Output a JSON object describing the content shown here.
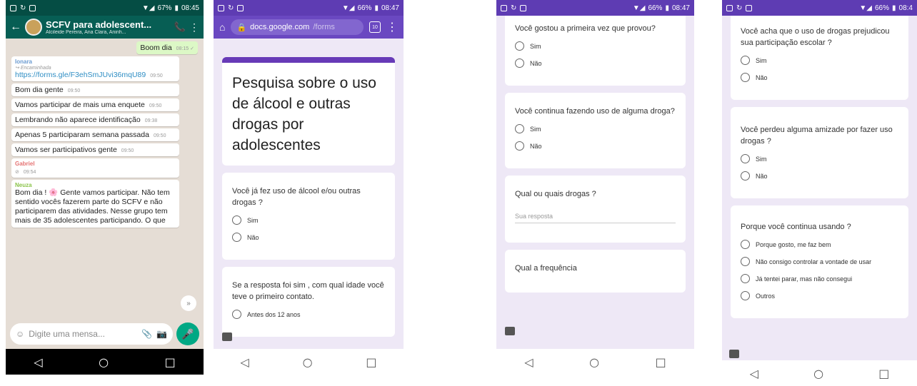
{
  "phone1": {
    "status": {
      "battery": "67%",
      "time": "08:45"
    },
    "header": {
      "title": "SCFV para adolescent...",
      "subtitle": "Alcileide Pereira, Ana Clara, Aninh..."
    },
    "messages": [
      {
        "out": true,
        "text": "Boom dia",
        "time": "08:15 ✓"
      },
      {
        "sender": "Ionara",
        "sender_color": "#6b9bd1",
        "forwarded": "Encaminhada",
        "link": "https://forms.gle/F3ehSmJUvi36mqU89",
        "time": "09:50"
      },
      {
        "text": "Bom dia gente",
        "time": "09:50"
      },
      {
        "text": "Vamos participar de mais uma enquete",
        "time": "09:50"
      },
      {
        "text": "Lembrando não aparece identificação",
        "time": "09:38"
      },
      {
        "text": "Apenas 5 participaram semana passada",
        "time": "09:50"
      },
      {
        "text": "Vamos ser participativos gente",
        "time": "09:50"
      },
      {
        "sender": "Gabriel",
        "sender_color": "#e57373",
        "text": "",
        "time": "09:54"
      },
      {
        "sender": "Neuza",
        "sender_color": "#8bc34a",
        "text": "Bom dia ! 🌸 Gente vamos participar. Não tem sentido vocês fazerem parte do SCFV e não participarem das atividades. Nesse grupo tem mais de 35 adolescentes participando. O que"
      }
    ],
    "input_placeholder": "Digite uma mensa..."
  },
  "phone2": {
    "status": {
      "battery": "66%",
      "time": "08:47"
    },
    "url_host": "docs.google.com",
    "url_path": "/forms",
    "tab_count": "10",
    "form_title": "Pesquisa sobre o uso de álcool e outras drogas por adolescentes",
    "q1": {
      "question": "Você já fez uso de álcool e/ou outras drogas ?",
      "options": [
        "Sim",
        "Não"
      ]
    },
    "q2": {
      "question": "Se a resposta foi sim , com qual idade você teve o primeiro contato.",
      "options": [
        "Antes dos 12 anos"
      ]
    }
  },
  "phone3": {
    "status": {
      "battery": "66%",
      "time": "08:47"
    },
    "q1": {
      "question": "Você gostou a primeira vez que provou?",
      "options": [
        "Sim",
        "Não"
      ]
    },
    "q2": {
      "question": "Você continua fazendo uso de alguma droga?",
      "options": [
        "Sim",
        "Não"
      ]
    },
    "q3": {
      "question": "Qual ou quais drogas ?",
      "placeholder": "Sua resposta"
    },
    "q4": {
      "question": "Qual a frequência"
    }
  },
  "phone4": {
    "status": {
      "battery": "66%",
      "time": "08:4"
    },
    "q1": {
      "question": "Você acha que o uso de drogas prejudicou sua participação escolar ?",
      "options": [
        "Sim",
        "Não"
      ]
    },
    "q2": {
      "question": "Você perdeu alguma amizade por fazer uso drogas ?",
      "options": [
        "Sim",
        "Não"
      ]
    },
    "q3": {
      "question": "Porque você continua usando ?",
      "options": [
        "Porque gosto, me faz bem",
        "Não consigo controlar a vontade de usar",
        "Já tentei parar, mas não consegui",
        "Outros"
      ]
    }
  },
  "nav": {
    "back": "◁",
    "home": "○",
    "recent": "□"
  }
}
